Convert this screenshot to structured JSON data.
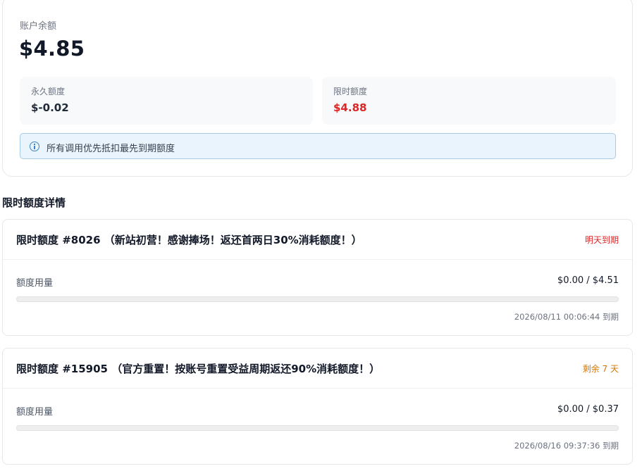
{
  "balance": {
    "label": "账户余额",
    "value": "$4.85",
    "permanent": {
      "label": "永久额度",
      "value": "$-0.02"
    },
    "limited": {
      "label": "限时额度",
      "value": "$4.88"
    },
    "notice": "所有调用优先抵扣最先到期额度"
  },
  "grants_section": {
    "title": "限时额度详情",
    "items": [
      {
        "title": "限时额度 #8026 （新站初营！感谢捧场！返还首两日30%消耗额度！）",
        "status": "明天到期",
        "status_color": "#dc2626",
        "usage_label": "额度用量",
        "usage": "$0.00 / $4.51",
        "used_fraction": 0,
        "expiry": "2026/08/11 00:06:44 到期"
      },
      {
        "title": "限时额度 #15905 （官方重置！按账号重置受益周期返还90%消耗额度！）",
        "status": "剩余 7 天",
        "status_color": "#d97706",
        "usage_label": "额度用量",
        "usage": "$0.00 / $0.37",
        "used_fraction": 0,
        "expiry": "2026/08/16 09:37:36 到期"
      }
    ]
  },
  "colors": {
    "negative": "#dc2626",
    "warning": "#d97706",
    "info_bg": "#eaf4fc",
    "info_border": "#a7cbe6"
  },
  "icons": {
    "notice": "info-circle-icon"
  }
}
